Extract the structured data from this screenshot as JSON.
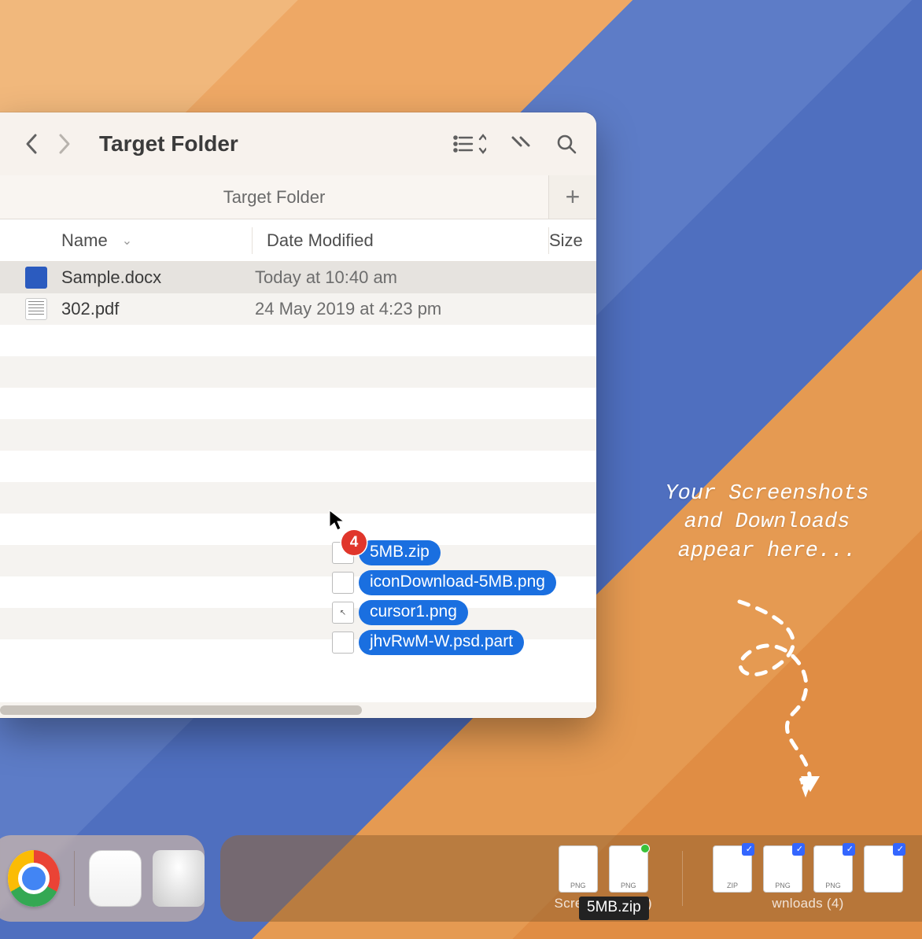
{
  "window": {
    "title": "Target Folder",
    "tab": "Target Folder",
    "columns": {
      "name": "Name",
      "date": "Date Modified",
      "size": "Size"
    },
    "rows": [
      {
        "name": "Sample.docx",
        "date": "Today at 10:40 am",
        "kind": "docx",
        "selected": true
      },
      {
        "name": "302.pdf",
        "date": "24 May 2019 at 4:23 pm",
        "kind": "pdf",
        "selected": false
      }
    ]
  },
  "drag": {
    "count": "4",
    "items": [
      {
        "name": "5MB.zip"
      },
      {
        "name": "iconDownload-5MB.png"
      },
      {
        "name": "cursor1.png"
      },
      {
        "name": "jhvRwM-W.psd.part"
      }
    ]
  },
  "hint": {
    "line1": "Your Screenshots",
    "line2": "and Downloads",
    "line3": "appear here..."
  },
  "dock": {
    "screenshots_label": "Screenshots (2)",
    "downloads_label": "wnloads (4)",
    "tooltip": "5MB.zip",
    "screenshots": [
      {
        "tag": "PNG"
      },
      {
        "tag": "PNG",
        "dot": true
      }
    ],
    "downloads": [
      {
        "tag": "ZIP",
        "selected": true
      },
      {
        "tag": "PNG",
        "selected": true
      },
      {
        "tag": "PNG",
        "selected": true
      },
      {
        "tag": "",
        "selected": true,
        "dot": true
      }
    ]
  }
}
